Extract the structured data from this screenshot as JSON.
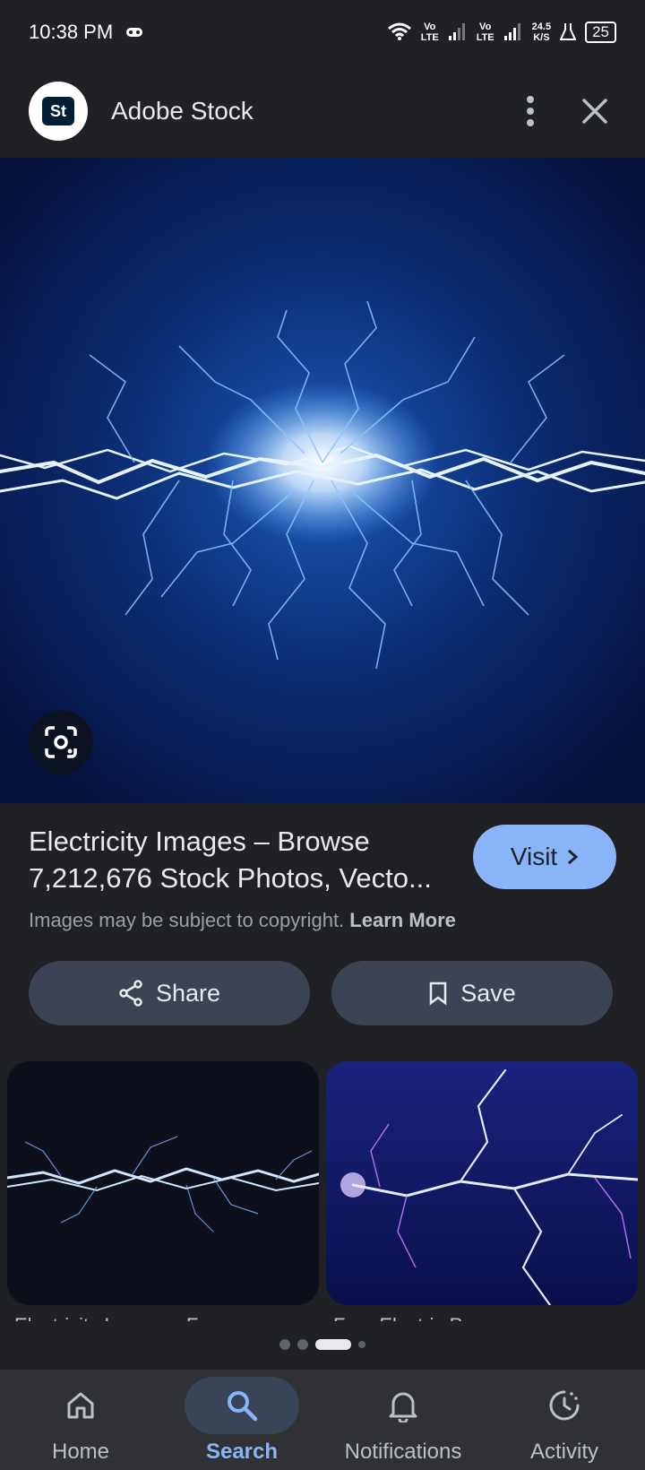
{
  "status": {
    "time": "10:38 PM",
    "net1": [
      "Vo",
      "LTE"
    ],
    "net2": [
      "Vo",
      "LTE"
    ],
    "speed": [
      "24.5",
      "K/S"
    ],
    "battery": "25"
  },
  "header": {
    "logo_text": "St",
    "site_name": "Adobe Stock"
  },
  "result": {
    "title": "Electricity Images – Browse 7,212,676 Stock Photos, Vecto...",
    "visit_label": "Visit",
    "copyright_text": "Images may be subject to copyright.",
    "learn_more": "Learn More"
  },
  "actions": {
    "share_label": "Share",
    "save_label": "Save"
  },
  "related": [
    {
      "caption": "Electricity Images - Free"
    },
    {
      "caption": "Free Electric Power"
    }
  ],
  "nav": [
    {
      "label": "Home",
      "icon": "home-icon"
    },
    {
      "label": "Search",
      "icon": "search-icon",
      "active": true
    },
    {
      "label": "Notifications",
      "icon": "bell-icon"
    },
    {
      "label": "Activity",
      "icon": "activity-icon"
    }
  ],
  "colors": {
    "accent": "#8ab4f8",
    "background": "#202124",
    "button": "#3c4453"
  }
}
